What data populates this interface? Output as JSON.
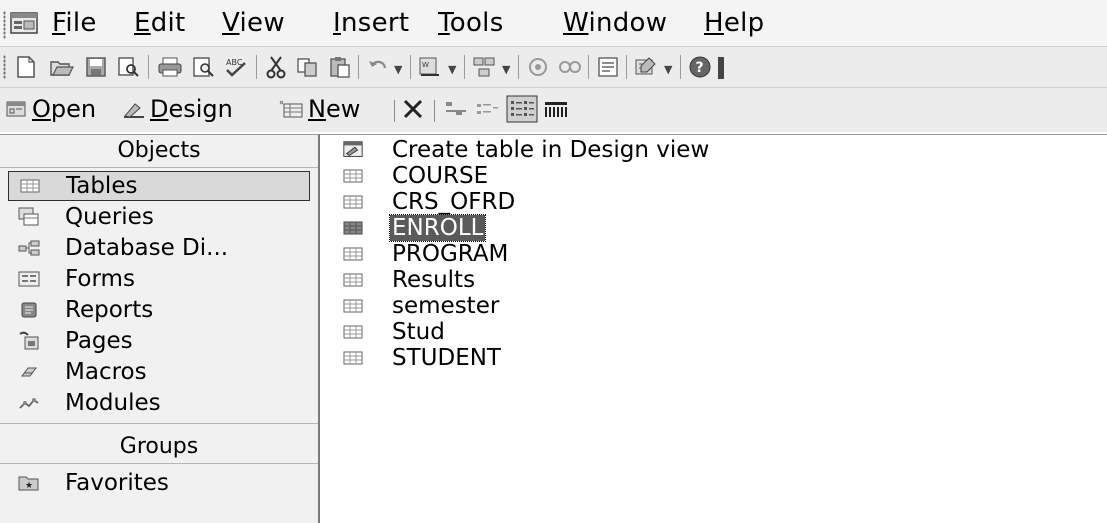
{
  "menubar": {
    "items": [
      {
        "label": "File",
        "accel": "F",
        "rest": "ile"
      },
      {
        "label": "Edit",
        "accel": "E",
        "rest": "dit"
      },
      {
        "label": "View",
        "accel": "V",
        "rest": "iew"
      },
      {
        "label": "Insert",
        "accel": "I",
        "rest": "nsert"
      },
      {
        "label": "Tools",
        "accel": "T",
        "rest": "ools"
      },
      {
        "label": "Window",
        "accel": "W",
        "rest": "indow"
      },
      {
        "label": "Help",
        "accel": "H",
        "rest": "elp"
      }
    ]
  },
  "toolbar": {
    "icons": [
      "new-icon",
      "open-icon",
      "save-icon",
      "file-search-icon",
      "print-icon",
      "print-preview-icon",
      "spelling-icon",
      "cut-icon",
      "copy-icon",
      "paste-icon",
      "undo-icon",
      "office-links-icon",
      "analyze-icon",
      "code-icon",
      "script-icon",
      "properties-icon",
      "new-object-icon",
      "help-icon"
    ]
  },
  "dbbar": {
    "open": {
      "accel": "O",
      "rest": "pen"
    },
    "design": {
      "accel": "D",
      "rest": "esign"
    },
    "new": {
      "accel": "N",
      "rest": "ew"
    }
  },
  "objects": {
    "header": "Objects",
    "items": [
      {
        "label": "Tables",
        "icon": "table-icon",
        "selected": true
      },
      {
        "label": "Queries",
        "icon": "query-icon"
      },
      {
        "label": "Database Di...",
        "icon": "diagram-icon"
      },
      {
        "label": "Forms",
        "icon": "form-icon"
      },
      {
        "label": "Reports",
        "icon": "report-icon"
      },
      {
        "label": "Pages",
        "icon": "page-icon"
      },
      {
        "label": "Macros",
        "icon": "macro-icon"
      },
      {
        "label": "Modules",
        "icon": "module-icon"
      }
    ],
    "groups_header": "Groups",
    "groups": [
      {
        "label": "Favorites",
        "icon": "favorites-icon"
      }
    ]
  },
  "list": {
    "create_label": "Create table in Design view",
    "tables": [
      "COURSE",
      "CRS_OFRD",
      "ENROLL",
      "PROGRAM",
      "Results",
      "semester",
      "Stud",
      "STUDENT"
    ],
    "selected": "ENROLL"
  }
}
